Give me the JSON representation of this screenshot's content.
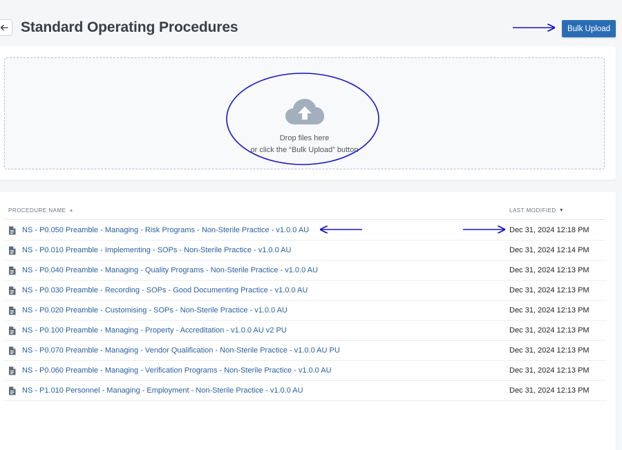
{
  "header": {
    "title": "Standard Operating Procedures",
    "bulk_upload_label": "Bulk Upload",
    "back_icon": "arrow-left-icon"
  },
  "dropzone": {
    "line1": "Drop files here",
    "line2": "or click the “Bulk Upload” button",
    "icon": "cloud-upload-icon"
  },
  "table": {
    "columns": {
      "name": "PROCEDURE NAME",
      "modified": "LAST MODIFIED"
    },
    "rows": [
      {
        "name": "NS - P0.050 Preamble - Managing - Risk Programs - Non-Sterile Practice - v1.0.0 AU",
        "modified": "Dec 31, 2024 12:18 PM"
      },
      {
        "name": "NS - P0.010 Preamble - Implementing - SOPs - Non-Sterile Practice - v1.0.0 AU",
        "modified": "Dec 31, 2024 12:14 PM"
      },
      {
        "name": "NS - P0.040 Preamble - Managing - Quality Programs - Non-Sterile Practice - v1.0.0 AU",
        "modified": "Dec 31, 2024 12:13 PM"
      },
      {
        "name": "NS - P0.030 Preamble - Recording - SOPs - Good Documenting Practice - v1.0.0 AU",
        "modified": "Dec 31, 2024 12:13 PM"
      },
      {
        "name": "NS - P0.020 Preamble - Customising - SOPs - Non-Sterile Practice - v1.0.0 AU",
        "modified": "Dec 31, 2024 12:13 PM"
      },
      {
        "name": "NS - P0.100 Preamble - Managing - Property - Accreditation - v1.0.0 AU v2 PU",
        "modified": "Dec 31, 2024 12:13 PM"
      },
      {
        "name": "NS - P0.070 Preamble - Managing - Vendor Qualification - Non-Sterile Practice - v1.0.0 AU PU",
        "modified": "Dec 31, 2024 12:13 PM"
      },
      {
        "name": "NS - P0.060 Preamble - Managing - Verification Programs - Non-Sterile Practice - v1.0.0 AU",
        "modified": "Dec 31, 2024 12:13 PM"
      },
      {
        "name": "NS - P1.010 Personnel - Managing - Employment - Non-Sterile Practice - v1.0.0 AU",
        "modified": "Dec 31, 2024 12:13 PM"
      }
    ]
  },
  "colors": {
    "accent": "#2a6db5",
    "link": "#2a5f9e",
    "annotation": "#1414c8"
  }
}
